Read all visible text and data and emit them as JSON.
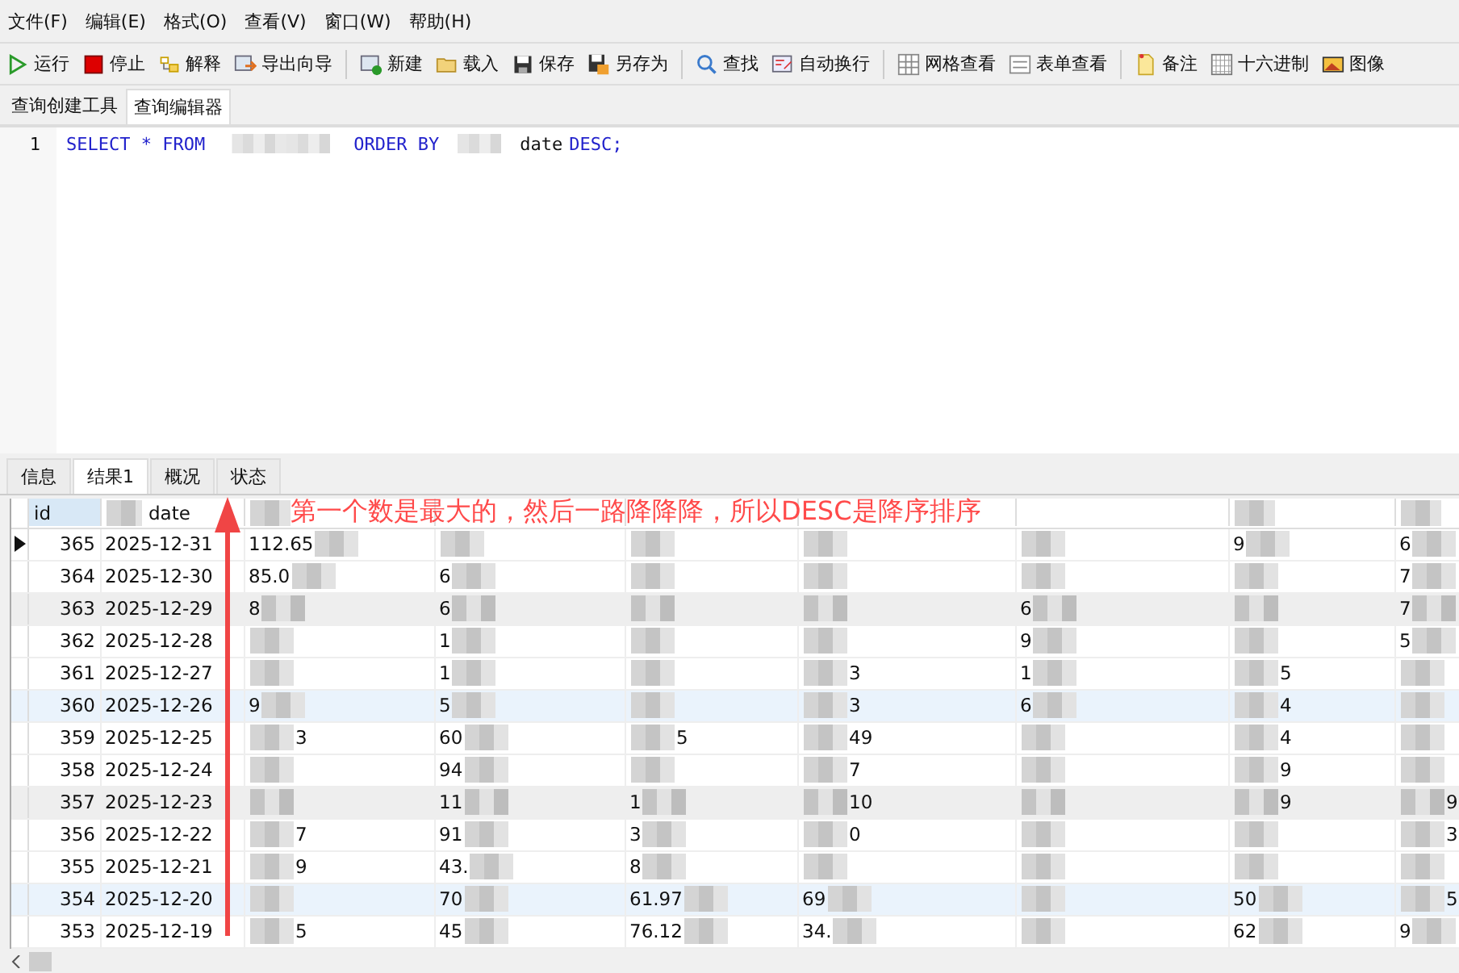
{
  "menu": [
    "文件(F)",
    "编辑(E)",
    "格式(O)",
    "查看(V)",
    "窗口(W)",
    "帮助(H)"
  ],
  "toolbar": [
    [
      "运行",
      "停止",
      "解释",
      "导出向导"
    ],
    [
      "新建",
      "载入",
      "保存",
      "另存为"
    ],
    [
      "查找",
      "自动换行"
    ],
    [
      "网格查看",
      "表单查看"
    ],
    [
      "备注",
      "十六进制",
      "图像"
    ]
  ],
  "editor_tabs": [
    {
      "label": "查询创建工具",
      "selected": false
    },
    {
      "label": "查询编辑器",
      "selected": true
    }
  ],
  "editor": {
    "line_number": "1",
    "tokens": [
      {
        "kind": "keyword",
        "text": "SELECT * FROM"
      },
      {
        "kind": "redacted"
      },
      {
        "kind": "keyword",
        "text": "ORDER BY"
      },
      {
        "kind": "redacted"
      },
      {
        "kind": "ident",
        "text": "date"
      },
      {
        "kind": "keyword",
        "text": "DESC;"
      }
    ]
  },
  "result_tabs": [
    {
      "label": "信息",
      "selected": false
    },
    {
      "label": "结果1",
      "selected": true
    },
    {
      "label": "概况",
      "selected": false
    },
    {
      "label": "状态",
      "selected": false
    }
  ],
  "table": {
    "columns": [
      {
        "label": "id",
        "redacted": false
      },
      {
        "label": "date",
        "redacted": true
      },
      {
        "redacted": true
      },
      {
        "redacted": false
      },
      {
        "redacted": false
      },
      {
        "redacted": false
      },
      {
        "redacted": false
      },
      {
        "redacted": true
      },
      {
        "redacted": true
      }
    ],
    "rows": [
      {
        "selected": true,
        "shaded": false,
        "highlighted": false,
        "cells": [
          "365",
          "2025-12-31",
          {
            "text": "112.65"
          },
          {},
          {},
          {},
          {},
          {
            "text": "9"
          },
          {
            "text": "6"
          }
        ]
      },
      {
        "selected": false,
        "shaded": false,
        "highlighted": false,
        "cells": [
          "364",
          "2025-12-30",
          {
            "text": "85.0"
          },
          {
            "text": "6"
          },
          {},
          {},
          {},
          {},
          {
            "text": "7"
          }
        ]
      },
      {
        "selected": false,
        "shaded": true,
        "highlighted": false,
        "cells": [
          "363",
          "2025-12-29",
          {
            "text": "8"
          },
          {
            "text": "6"
          },
          {},
          {},
          {
            "text": "6"
          },
          {},
          {
            "text": "7"
          }
        ]
      },
      {
        "selected": false,
        "shaded": false,
        "highlighted": false,
        "cells": [
          "362",
          "2025-12-28",
          {},
          {
            "text": "1"
          },
          {},
          {},
          {
            "text": "9"
          },
          {},
          {
            "text": "5"
          }
        ]
      },
      {
        "selected": false,
        "shaded": false,
        "highlighted": false,
        "cells": [
          "361",
          "2025-12-27",
          {},
          {
            "text": "1"
          },
          {},
          {
            "tail": "3"
          },
          {
            "text": "1"
          },
          {
            "tail": "5"
          },
          {}
        ]
      },
      {
        "selected": false,
        "shaded": false,
        "highlighted": true,
        "cells": [
          "360",
          "2025-12-26",
          {
            "text": "9"
          },
          {
            "text": "5"
          },
          {},
          {
            "tail": "3"
          },
          {
            "text": "6"
          },
          {
            "tail": "4"
          },
          {}
        ]
      },
      {
        "selected": false,
        "shaded": false,
        "highlighted": false,
        "cells": [
          "359",
          "2025-12-25",
          {
            "tail": "3"
          },
          {
            "text": "60"
          },
          {
            "tail": "5"
          },
          {
            "tail": "49"
          },
          {},
          {
            "tail": "4"
          },
          {}
        ]
      },
      {
        "selected": false,
        "shaded": false,
        "highlighted": false,
        "cells": [
          "358",
          "2025-12-24",
          {},
          {
            "text": "94"
          },
          {},
          {
            "tail": "7"
          },
          {},
          {
            "tail": "9"
          },
          {}
        ]
      },
      {
        "selected": false,
        "shaded": true,
        "highlighted": false,
        "cells": [
          "357",
          "2025-12-23",
          {},
          {
            "text": "11"
          },
          {
            "text": "1"
          },
          {
            "tail": "10"
          },
          {},
          {
            "tail": "9"
          },
          {
            "tail": "9"
          }
        ]
      },
      {
        "selected": false,
        "shaded": false,
        "highlighted": false,
        "cells": [
          "356",
          "2025-12-22",
          {
            "tail": "7"
          },
          {
            "text": "91"
          },
          {
            "text": "3"
          },
          {
            "tail": "0"
          },
          {},
          {},
          {
            "tail": "3"
          }
        ]
      },
      {
        "selected": false,
        "shaded": false,
        "highlighted": false,
        "cells": [
          "355",
          "2025-12-21",
          {
            "tail": "9"
          },
          {
            "text": "43."
          },
          {
            "text": "8"
          },
          {},
          {},
          {},
          {}
        ]
      },
      {
        "selected": false,
        "shaded": false,
        "highlighted": true,
        "cells": [
          "354",
          "2025-12-20",
          {},
          {
            "text": "70"
          },
          {
            "text": "61.97"
          },
          {
            "text": "69"
          },
          {},
          {
            "text": "50"
          },
          {
            "tail": "5"
          }
        ]
      },
      {
        "selected": false,
        "shaded": false,
        "highlighted": false,
        "cells": [
          "353",
          "2025-12-19",
          {
            "tail": "5"
          },
          {
            "text": "45"
          },
          {
            "text": "76.12"
          },
          {
            "text": "34."
          },
          {},
          {
            "text": "62"
          },
          {
            "text": "9"
          }
        ]
      }
    ]
  },
  "annotation": {
    "text": "第一个数是最大的，然后一路降降降，所以DESC是降序排序"
  }
}
